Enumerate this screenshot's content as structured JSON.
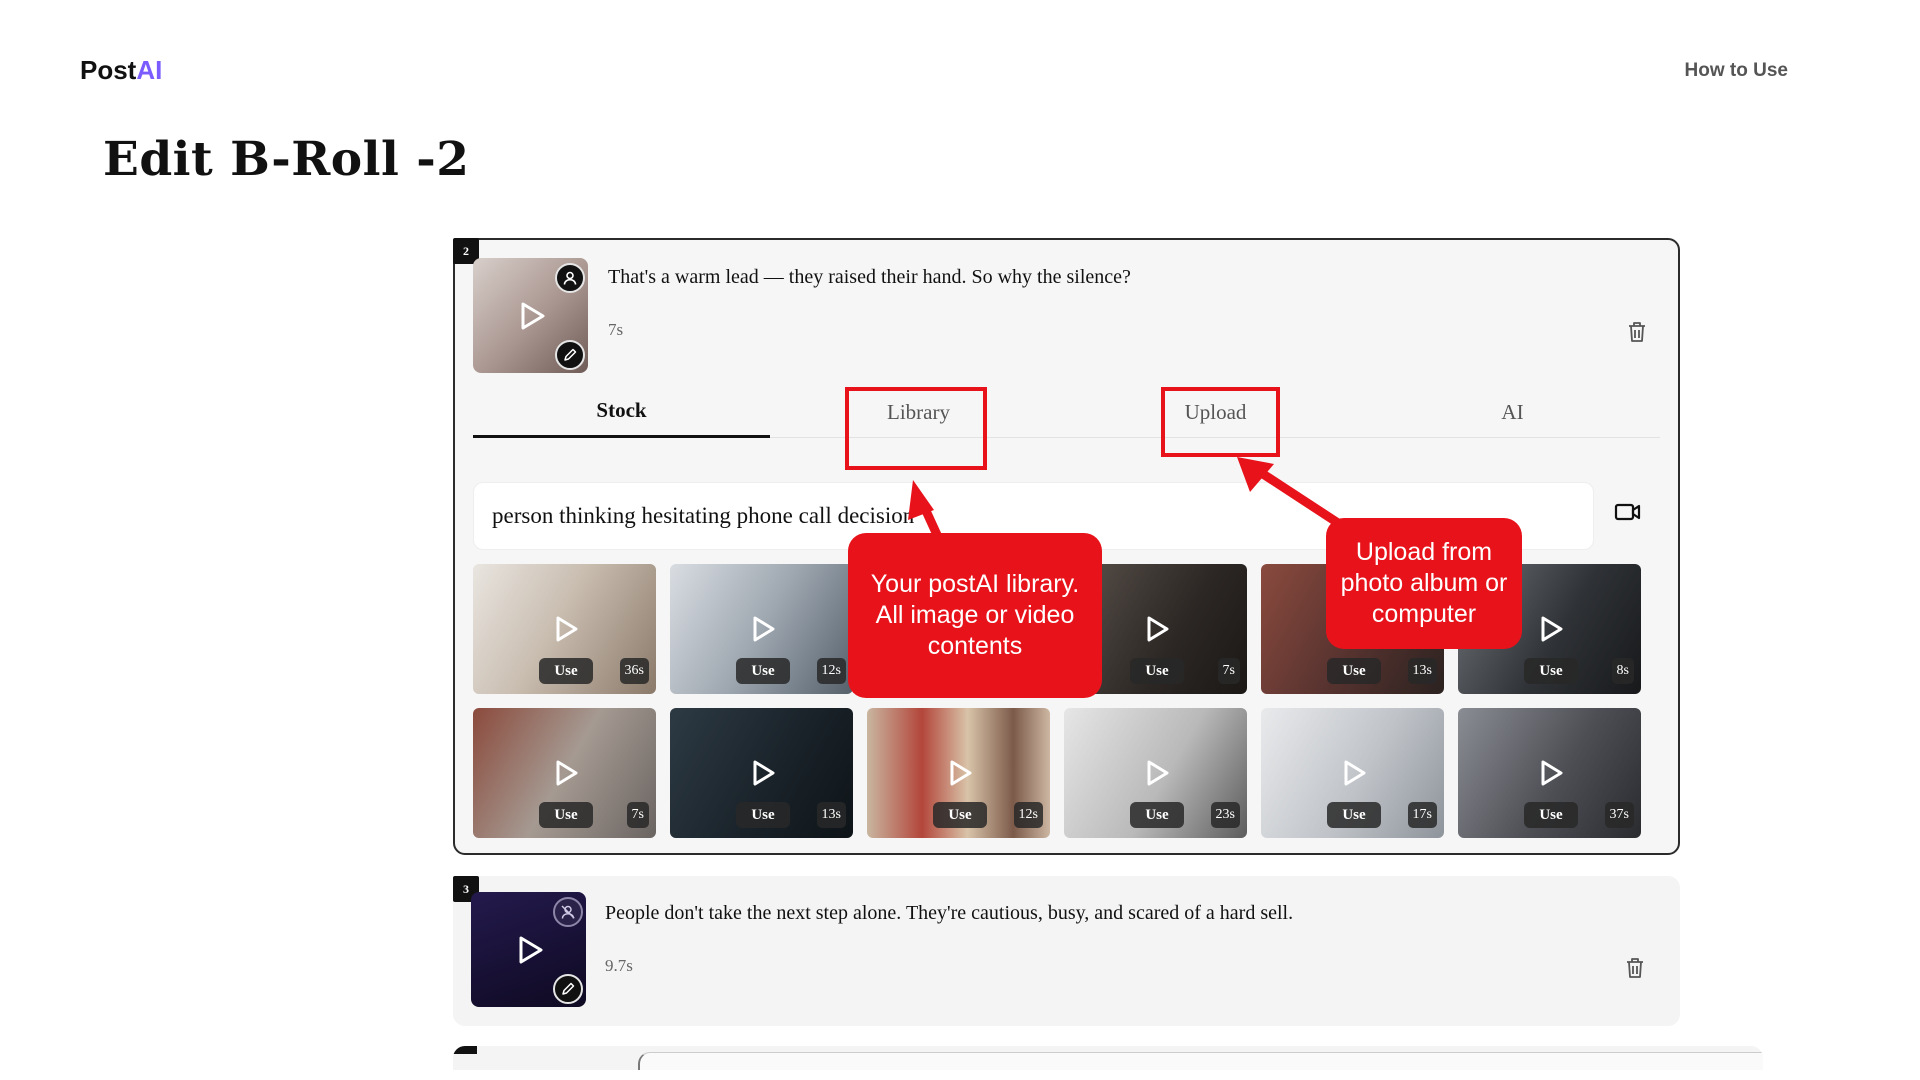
{
  "header": {
    "logo_main": "Post",
    "logo_accent": "AI",
    "how_to_use": "How to Use"
  },
  "page": {
    "title": "Edit B-Roll -2"
  },
  "scene2": {
    "number": "2",
    "text": "That's a warm lead — they raised their hand. So why the silence?",
    "duration": "7s",
    "tabs": [
      {
        "label": "Stock",
        "active": true
      },
      {
        "label": "Library",
        "active": false
      },
      {
        "label": "Upload",
        "active": false
      },
      {
        "label": "AI",
        "active": false
      }
    ],
    "search_query": "person thinking hesitating phone call decision",
    "use_label": "Use",
    "results_row1": [
      {
        "duration": "36s"
      },
      {
        "duration": "12s"
      },
      {
        "duration": ""
      },
      {
        "duration": "7s"
      },
      {
        "duration": "13s"
      },
      {
        "duration": "8s"
      }
    ],
    "results_row2": [
      {
        "duration": "7s"
      },
      {
        "duration": "13s"
      },
      {
        "duration": "12s"
      },
      {
        "duration": "23s"
      },
      {
        "duration": "17s"
      },
      {
        "duration": "37s"
      }
    ]
  },
  "annotations": {
    "library_callout": "Your postAI library. All image or video contents",
    "upload_callout": "Upload from photo album or computer",
    "color": "#e8121b"
  },
  "scene3": {
    "number": "3",
    "text": "People don't take the next step alone. They're cautious, busy, and scared of a hard sell.",
    "duration": "9.7s"
  },
  "icons": [
    "person-icon",
    "pencil-icon",
    "play-icon",
    "trash-icon",
    "video-camera-icon"
  ],
  "colors": {
    "accent": "#7b5cff",
    "annotation": "#e8121b"
  }
}
